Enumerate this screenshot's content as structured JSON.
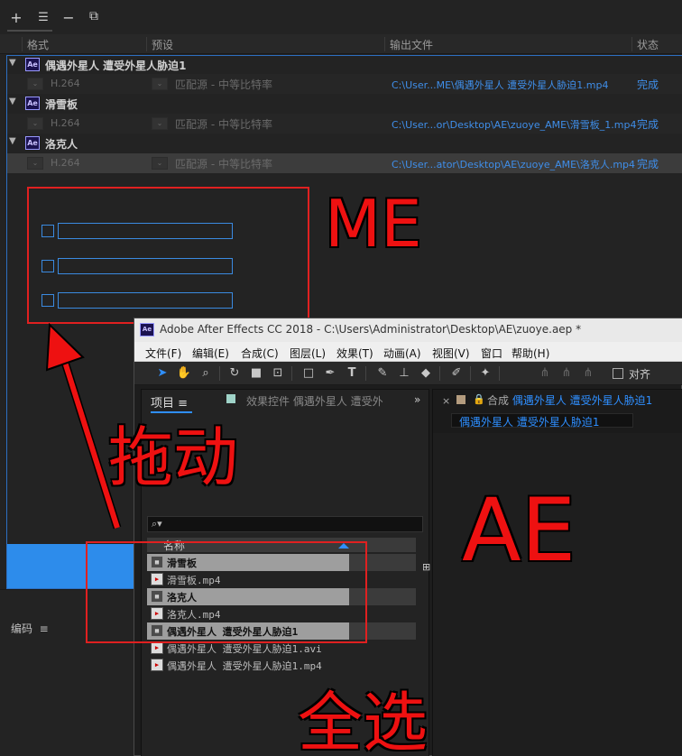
{
  "me": {
    "columns": {
      "format": "格式",
      "preset": "预设",
      "output": "输出文件",
      "status": "状态"
    },
    "groups": [
      {
        "name": "偶遇外星人 遭受外星人胁迫1",
        "format": "H.264",
        "preset": "匹配源 - 中等比特率",
        "output": "C:\\User...ME\\偶遇外星人 遭受外星人胁迫1.mp4",
        "status": "完成"
      },
      {
        "name": "滑雪板",
        "format": "H.264",
        "preset": "匹配源 - 中等比特率",
        "output": "C:\\User...or\\Desktop\\AE\\zuoye_AME\\滑雪板_1.mp4",
        "status": "完成"
      },
      {
        "name": "洛克人",
        "format": "H.264",
        "preset": "匹配源 - 中等比特率",
        "output": "C:\\User...ator\\Desktop\\AE\\zuoye_AME\\洛克人.mp4",
        "status": "完成"
      }
    ],
    "encoding_panel": "编码"
  },
  "toolbar": {
    "add": "+",
    "settings": "☰",
    "remove": "−",
    "duplicate": "⧉"
  },
  "ae": {
    "badge": "Ae",
    "title": "Adobe After Effects CC 2018 - C:\\Users\\Administrator\\Desktop\\AE\\zuoye.aep *",
    "menu": [
      "文件(F)",
      "编辑(E)",
      "合成(C)",
      "图层(L)",
      "效果(T)",
      "动画(A)",
      "视图(V)",
      "窗口",
      "帮助(H)"
    ],
    "align_label": "对齐",
    "project_tab": "项目",
    "effects_tab": "效果控件 偶遇外星人 遭受外",
    "column_name": "名称",
    "search_placeholder": "",
    "project_items": [
      {
        "name": "滑雪板",
        "type": "comp",
        "selected": true
      },
      {
        "name": "滑雪板.mp4",
        "type": "file",
        "selected": false
      },
      {
        "name": "洛克人",
        "type": "comp",
        "selected": true
      },
      {
        "name": "洛克人.mp4",
        "type": "file",
        "selected": false
      },
      {
        "name": "偶遇外星人 遭受外星人胁迫1",
        "type": "comp",
        "selected": true
      },
      {
        "name": "偶遇外星人 遭受外星人胁迫1.avi",
        "type": "file",
        "selected": false
      },
      {
        "name": "偶遇外星人 遭受外星人胁迫1.mp4",
        "type": "file",
        "selected": false
      }
    ],
    "comp_tab_prefix": "合成",
    "comp_tab_name": "偶遇外星人 遭受外星人胁迫1",
    "comp_subname": "偶遇外星人 遭受外星人胁迫1"
  },
  "annotations": {
    "me": "ME",
    "drag": "拖动",
    "ae": "AE",
    "select_all": "全选"
  },
  "colors": {
    "accent": "#2f8fff",
    "link": "#3f8ee9",
    "annotation": "#ee1111",
    "ae_badge_bg": "#1b1250"
  }
}
